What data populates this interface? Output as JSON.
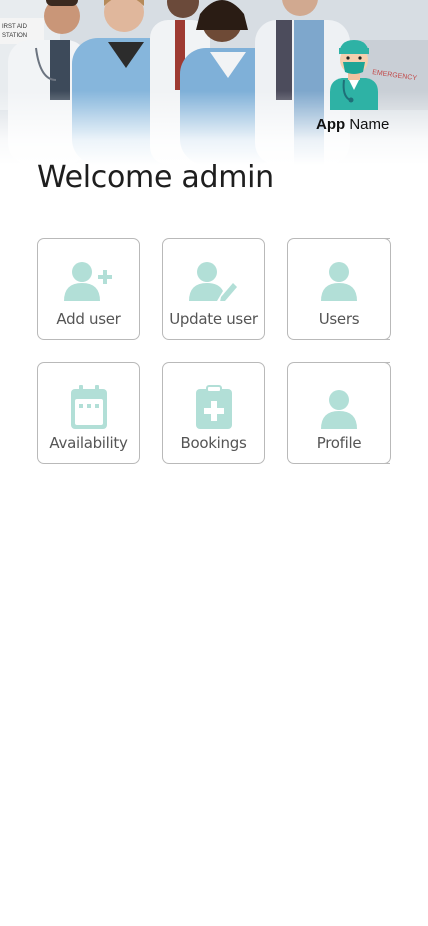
{
  "header": {
    "app_name_bold": "App",
    "app_name_rest": "Name",
    "logo_icon": "doctor-avatar-icon",
    "photo_sign_left": "IRST AID STATION",
    "photo_sign_right": "EMERGENCY"
  },
  "welcome": {
    "text": "Welcome admin"
  },
  "tiles": [
    {
      "label": "Add user",
      "icon": "add-user-icon"
    },
    {
      "label": "Update user",
      "icon": "edit-user-icon"
    },
    {
      "label": "Users",
      "icon": "users-icon"
    },
    {
      "label": "Availability",
      "icon": "calendar-icon"
    },
    {
      "label": "Bookings",
      "icon": "medical-clipboard-icon"
    },
    {
      "label": "Profile",
      "icon": "profile-icon"
    }
  ],
  "colors": {
    "icon": "#b2dfd7",
    "tile_border": "#b9b9b9",
    "label": "#555555",
    "title": "#1e1e1e",
    "scrub": "#6fa8d6"
  }
}
